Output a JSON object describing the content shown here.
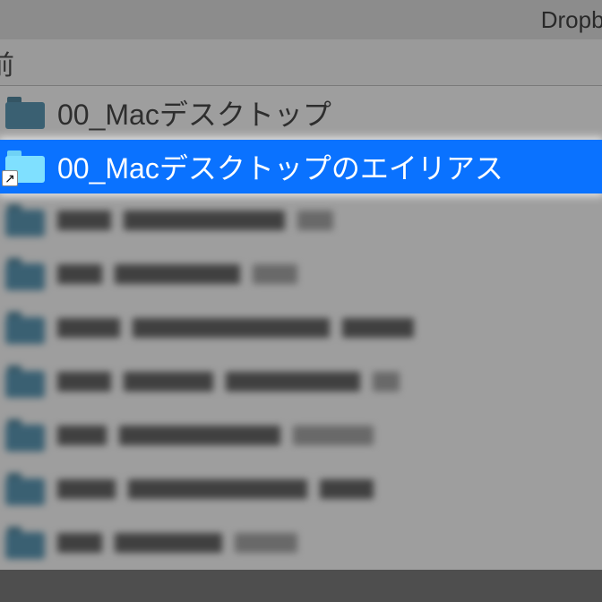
{
  "window": {
    "title": "Dropbox"
  },
  "columns": {
    "name": "前"
  },
  "rows": [
    {
      "name": "00_Macデスクトップ",
      "selected": false,
      "alias": false,
      "icon": "folder-dark"
    },
    {
      "name": "00_Macデスクトップのエイリアス",
      "selected": true,
      "alias": true,
      "icon": "folder-light"
    }
  ],
  "colors": {
    "selection": "#0a72ff",
    "folder_dark": "#4a8fb0",
    "folder_light": "#7fe0ff"
  }
}
